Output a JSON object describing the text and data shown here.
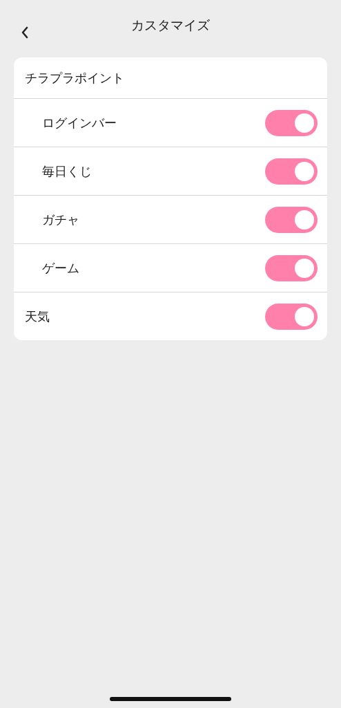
{
  "header": {
    "title": "カスタマイズ"
  },
  "settings": [
    {
      "label": "チラプラポイント",
      "kind": "group",
      "children": [
        {
          "label": "ログインバー",
          "kind": "toggle",
          "on": true
        },
        {
          "label": "毎日くじ",
          "kind": "toggle",
          "on": true
        },
        {
          "label": "ガチャ",
          "kind": "toggle",
          "on": true
        },
        {
          "label": "ゲーム",
          "kind": "toggle",
          "on": true
        }
      ]
    },
    {
      "label": "天気",
      "kind": "toggle",
      "on": true
    }
  ]
}
